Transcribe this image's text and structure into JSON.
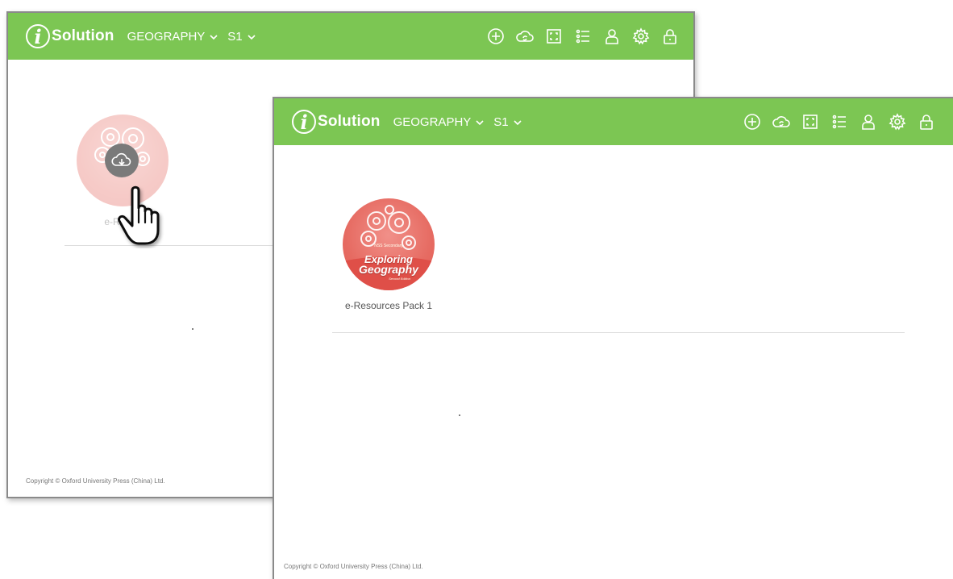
{
  "app": {
    "logo_letter": "i",
    "logo_text": "Solution",
    "subject": "GEOGRAPHY",
    "level": "S1",
    "toolbar_icons": [
      "add-circle-icon",
      "cloud-sync-icon",
      "fullscreen-icon",
      "list-icon",
      "user-icon",
      "gear-icon",
      "lock-icon"
    ],
    "brand_color": "#7cc653"
  },
  "back_window": {
    "resource": {
      "label": "e-Resou",
      "state": "downloading",
      "overlay_icon": "cloud-download-icon"
    },
    "copyright": "Copyright © Oxford University Press (China) Ltd."
  },
  "front_window": {
    "resource": {
      "cover_sub": "NSS Secondary",
      "cover_title_1": "Exploring",
      "cover_title_2": "Geography",
      "cover_edition": "Second Edition",
      "label": "e-Resources Pack 1"
    },
    "copyright": "Copyright © Oxford University Press (China) Ltd."
  },
  "cursor": {
    "icon": "hand-pointer-icon"
  }
}
